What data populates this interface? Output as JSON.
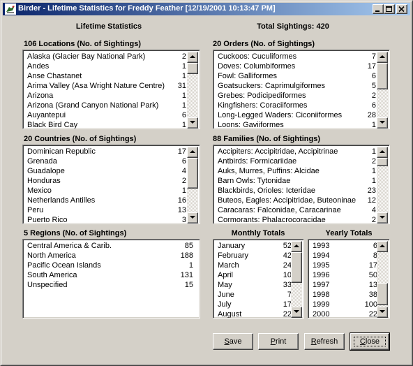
{
  "window": {
    "title": "Birder - Lifetime Statistics for Freddy Feather [12/19/2001 10:13:47 PM]"
  },
  "header": {
    "left": "Lifetime Statistics",
    "right": "Total Sightings: 420"
  },
  "locations": {
    "label": "106 Locations (No. of Sightings)",
    "items": [
      {
        "name": "Alaska (Glacier Bay National Park)",
        "count": "2"
      },
      {
        "name": "Andes",
        "count": "1"
      },
      {
        "name": "Anse Chastanet",
        "count": "1"
      },
      {
        "name": "Arima Valley (Asa Wright Nature Centre)",
        "count": "31"
      },
      {
        "name": "Arizona",
        "count": "1"
      },
      {
        "name": "Arizona (Grand Canyon National Park)",
        "count": "1"
      },
      {
        "name": "Auyantepui",
        "count": "6"
      },
      {
        "name": "Black Bird Cay",
        "count": "1"
      }
    ]
  },
  "orders": {
    "label": "20 Orders (No. of Sightings)",
    "items": [
      {
        "name": "Cuckoos: Cuculiformes",
        "count": "7"
      },
      {
        "name": "Doves: Columbiformes",
        "count": "17"
      },
      {
        "name": "Fowl: Galliformes",
        "count": "6"
      },
      {
        "name": "Goatsuckers: Caprimulgiformes",
        "count": "5"
      },
      {
        "name": "Grebes: Podicipediformes",
        "count": "2"
      },
      {
        "name": "Kingfishers: Coraciiformes",
        "count": "6"
      },
      {
        "name": "Long-Legged Waders: Ciconiiformes",
        "count": "28"
      },
      {
        "name": "Loons: Gaviiformes",
        "count": "1"
      }
    ]
  },
  "countries": {
    "label": "20 Countries (No. of Sightings)",
    "items": [
      {
        "name": "Dominican Republic",
        "count": "17"
      },
      {
        "name": "Grenada",
        "count": "6"
      },
      {
        "name": "Guadalope",
        "count": "4"
      },
      {
        "name": "Honduras",
        "count": "2"
      },
      {
        "name": "Mexico",
        "count": "1"
      },
      {
        "name": "Netherlands Antilles",
        "count": "16"
      },
      {
        "name": "Peru",
        "count": "13"
      },
      {
        "name": "Puerto Rico",
        "count": "3"
      }
    ]
  },
  "families": {
    "label": "88 Families (No. of Sightings)",
    "items": [
      {
        "name": "Accipiters: Accipitridae, Accipitrinae",
        "count": "1"
      },
      {
        "name": "Antbirds: Formicariidae",
        "count": "2"
      },
      {
        "name": "Auks, Murres, Puffins: Alcidae",
        "count": "1"
      },
      {
        "name": "Barn Owls: Tytonidae",
        "count": "1"
      },
      {
        "name": "Blackbirds, Orioles: Icteridae",
        "count": "23"
      },
      {
        "name": "Buteos, Eagles: Accipitridae, Buteoninae",
        "count": "12"
      },
      {
        "name": "Caracaras: Falconidae, Caracarinae",
        "count": "4"
      },
      {
        "name": "Cormorants: Phalacrocoracidae",
        "count": "2"
      }
    ]
  },
  "regions": {
    "label": "5 Regions (No. of Sightings)",
    "items": [
      {
        "name": "Central America & Carib.",
        "count": "85"
      },
      {
        "name": "North America",
        "count": "188"
      },
      {
        "name": "Pacific Ocean Islands",
        "count": "1"
      },
      {
        "name": "South America",
        "count": "131"
      },
      {
        "name": "Unspecified",
        "count": "15"
      }
    ]
  },
  "monthly": {
    "label": "Monthly Totals",
    "items": [
      {
        "name": "January",
        "count": "52"
      },
      {
        "name": "February",
        "count": "42"
      },
      {
        "name": "March",
        "count": "24"
      },
      {
        "name": "April",
        "count": "10"
      },
      {
        "name": "May",
        "count": "33"
      },
      {
        "name": "June",
        "count": "7"
      },
      {
        "name": "July",
        "count": "17"
      },
      {
        "name": "August",
        "count": "22"
      }
    ]
  },
  "yearly": {
    "label": "Yearly Totals",
    "items": [
      {
        "name": "1993",
        "count": "6"
      },
      {
        "name": "1994",
        "count": "8"
      },
      {
        "name": "1995",
        "count": "17"
      },
      {
        "name": "1996",
        "count": "50"
      },
      {
        "name": "1997",
        "count": "13"
      },
      {
        "name": "1998",
        "count": "38"
      },
      {
        "name": "1999",
        "count": "100"
      },
      {
        "name": "2000",
        "count": "22"
      }
    ]
  },
  "buttons": {
    "save": {
      "mnemonic": "S",
      "rest": "ave"
    },
    "print": {
      "mnemonic": "P",
      "rest": "rint"
    },
    "refresh": {
      "mnemonic": "R",
      "rest": "efresh"
    },
    "close": {
      "mnemonic": "C",
      "rest": "lose"
    }
  },
  "icons": {
    "app": "bird-icon",
    "minimize": "minimize-icon",
    "maximize": "maximize-icon",
    "close": "close-icon",
    "scroll_up": "scroll-up-arrow-icon",
    "scroll_down": "scroll-down-arrow-icon"
  }
}
